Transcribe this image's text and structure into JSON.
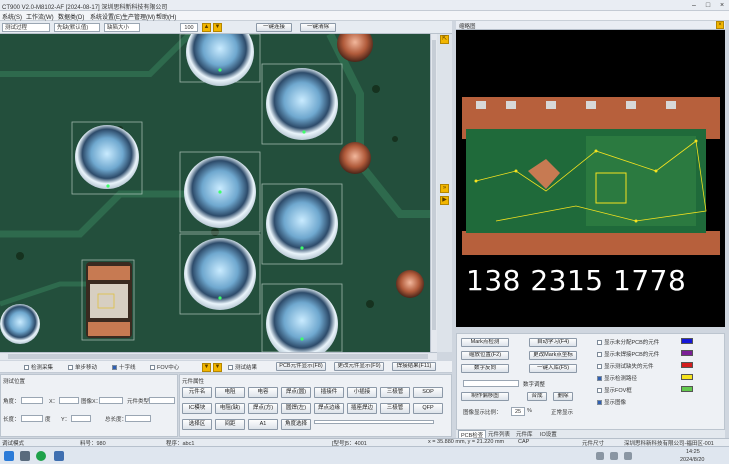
{
  "title": "CT900 V2.0-M8102-AF [2024-08-17] 深圳思科新科技有限公司",
  "menu": [
    "系统(S)",
    "工作流(W)",
    "数据类(D)",
    "系统设置(E)",
    "生产管理(M)",
    "帮助(H)"
  ],
  "toolbar": {
    "zoom_value": "100",
    "combo1": "测试过程",
    "combo2": "先缺(默认值)",
    "combo3": "缺陷大小",
    "btn_connect": "一键连接",
    "btn_clear": "一键清除"
  },
  "options_row": [
    "检测采集",
    "单步移动",
    "十字线",
    "FOV中心",
    "测试结果",
    "PCB元件显示(F8)",
    "更改元件显示(F9)",
    "焊接结果(F11)"
  ],
  "bottom_left": {
    "title": "测试位置",
    "labels": [
      "角度：",
      "X：",
      "图像X：",
      "Y：",
      "步进(Y)：",
      "总长度：",
      "元件类型：",
      "长度：",
      "度"
    ]
  },
  "component_panel": {
    "title": "元件属性",
    "row1": [
      "元件名",
      "电阻",
      "电容",
      "焊点(圆)",
      "插接件",
      "小插接",
      "三极管",
      "SOP"
    ],
    "row2": [
      "IC模块",
      "电阻(缺)",
      "焊点(方)",
      "圆焊(左)",
      "焊点边缘",
      "插座焊边",
      "三极管",
      "QFP"
    ],
    "row3": [
      "选择区",
      "间距",
      "A1",
      "角度选择"
    ]
  },
  "rightview": {
    "header": "缩略图",
    "phone": "138 2315 1778"
  },
  "controls": {
    "buttons": [
      "Mark点检测",
      "自动学习(F4)",
      "缩放位置(F2)",
      "更改Mark点坐标",
      "数字反向",
      "一键入库(F5)",
      "制作偏移图",
      "合成",
      "删除"
    ],
    "save_label": "数字调整",
    "precision_label": "图像显示比例：",
    "precision_value": "25",
    "pct": "%",
    "normal_display": "正常显示"
  },
  "legend": [
    {
      "label": "显示未分配PCB的元件",
      "color": "#1518d8",
      "on": false
    },
    {
      "label": "显示未焊接PCB的元件",
      "color": "#7a1f96",
      "on": false
    },
    {
      "label": "显示测试缺失的元件",
      "color": "#d21d1d",
      "on": false
    },
    {
      "label": "显示检测路径",
      "color": "#f5e31f",
      "on": true
    },
    {
      "label": "显示FOV框",
      "color": "#63c94d",
      "on": false
    },
    {
      "label": "显示图像",
      "color": "",
      "on": true
    }
  ],
  "tabs": [
    "PCB检查",
    "元件列表",
    "元件库",
    "IO设置"
  ],
  "status": {
    "mode": "调试模式",
    "count": "料号：980",
    "prog": "程序：abc1",
    "board": "[型号]5：4001",
    "coords": "x = 35.880 mm, y = 21.220 mm",
    "caps": "CAP",
    "size": "元件尺寸",
    "company": "深圳思科新科技有限公司-福田区-001"
  },
  "taskbar": {
    "time": "14:25",
    "date": "2024/8/20"
  }
}
